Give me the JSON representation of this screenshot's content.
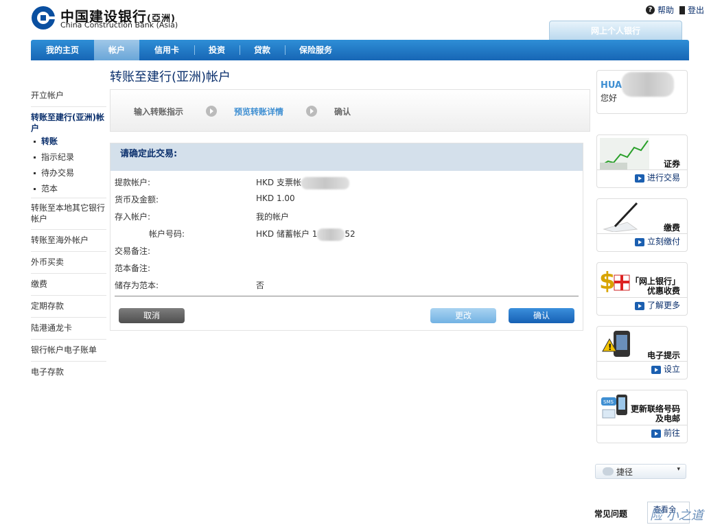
{
  "brand": {
    "name_cn": "中国建设银行",
    "name_cn_sub": "(亞洲)",
    "name_en": "China Construction Bank (Asia)"
  },
  "top_links": {
    "help": "帮助",
    "logout": "登出"
  },
  "ebank_tab": "网上个人银行",
  "nav": {
    "items": [
      "我的主页",
      "帐户",
      "信用卡",
      "投资",
      "贷款",
      "保险服务"
    ],
    "active_index": 1
  },
  "left_menu": {
    "open_account": "开立帐户",
    "group_title": "转账至建行(亚洲)帐户",
    "sub": [
      "转账",
      "指示纪录",
      "待办交易",
      "范本"
    ],
    "items": [
      "转账至本地其它银行帐户",
      "转账至海外帐户",
      "外币买卖",
      "缴费",
      "定期存款",
      "陆港通龙卡",
      "银行帐户电子账单",
      "电子存款"
    ]
  },
  "page": {
    "title": "转账至建行(亚洲)帐户",
    "steps": [
      "输入转账指示",
      "预览转账详情",
      "确认"
    ],
    "current_step": 1,
    "confirm_heading": "请确定此交易:",
    "rows": [
      {
        "label": "提款帐户:",
        "value": "HKD 支票帐"
      },
      {
        "label": "货币及金额:",
        "value": "HKD 1.00"
      },
      {
        "label": "存入帐户:",
        "value": "我的帐户"
      },
      {
        "label": "帐户号码:",
        "value": "HKD 储蓄帐户 1"
      },
      {
        "label": "交易备注:",
        "value": ""
      },
      {
        "label": "范本备注:",
        "value": ""
      },
      {
        "label": "储存为范本:",
        "value": "否"
      }
    ],
    "row4_suffix": "52",
    "buttons": {
      "cancel": "取消",
      "modify": "更改",
      "confirm": "确认"
    }
  },
  "right": {
    "user": {
      "name": "HUA",
      "greeting": "您好"
    },
    "cards": [
      {
        "title": "证券",
        "link": "进行交易"
      },
      {
        "title": "缴费",
        "link": "立刻缴付"
      },
      {
        "title": "「网上银行」\n优惠收费",
        "link": "了解更多"
      },
      {
        "title": "电子提示",
        "link": "设立"
      },
      {
        "title": "更新联络号码\n及电邮",
        "link": "前往"
      }
    ],
    "shortcut": "捷径",
    "faq": "常见问题",
    "more": "查看全"
  },
  "watermark": "险 小之道"
}
